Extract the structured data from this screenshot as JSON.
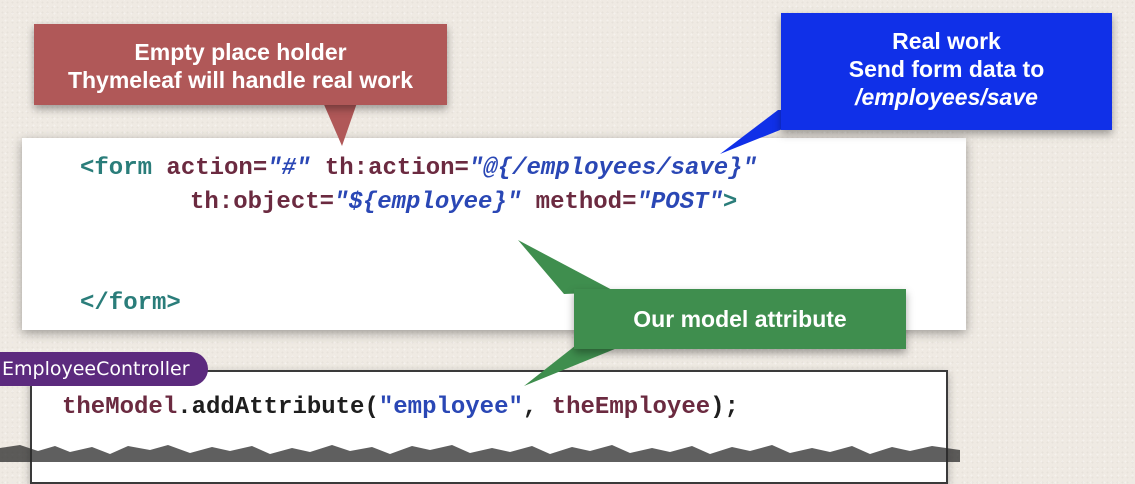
{
  "annotations": {
    "placeholder_callout": {
      "line1": "Empty place holder",
      "line2": "Thymeleaf will handle real work"
    },
    "real_work_callout": {
      "line1": "Real work",
      "line2": "Send form data to",
      "line3": "/employees/save"
    },
    "model_attribute_callout": {
      "label": "Our model attribute"
    }
  },
  "html_code": {
    "line1": {
      "open_tag": "<form ",
      "attr1": "action=",
      "val1": "\"#\"",
      "attr2": " th:action=",
      "val2": "\"@{/employees/save}\""
    },
    "line2": {
      "attr1": "th:object=",
      "val1": "\"${employee}\"",
      "attr2": " method=",
      "val2": "\"POST\"",
      "close": ">"
    },
    "line3": {
      "close_tag": "</form>"
    }
  },
  "controller": {
    "tab_label": "EmployeeController",
    "code": {
      "object": "theModel",
      "dot": ".",
      "method": "addAttribute(",
      "string": "\"employee\"",
      "sep": ", ",
      "arg": "theEmployee",
      "end": ");"
    }
  },
  "colors": {
    "placeholder_callout": "#b05858",
    "real_work_callout": "#1030e8",
    "model_attribute_callout": "#3f8e4e",
    "controller_tab": "#5c2a7e",
    "code_tag": "#2a7d7a",
    "code_attribute": "#6b2a40",
    "code_value": "#2a47b5"
  }
}
